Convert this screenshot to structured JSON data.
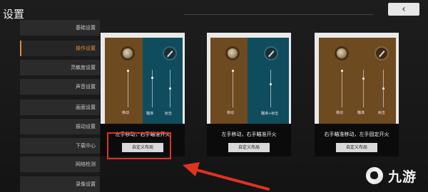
{
  "header": {
    "title": "设置",
    "close_icon": "back-arrow-icon"
  },
  "sidebar": {
    "items": [
      {
        "label": "基础设置",
        "active": false
      },
      {
        "label": "操作设置",
        "active": true
      },
      {
        "label": "灵敏度设置",
        "active": false
      },
      {
        "label": "声音设置",
        "active": false
      },
      {
        "label": "画面设置",
        "active": false
      },
      {
        "label": "振动设置",
        "active": false
      },
      {
        "label": "下载中心",
        "active": false
      },
      {
        "label": "网络检测",
        "active": false
      },
      {
        "label": "录像设置",
        "active": false
      }
    ]
  },
  "layouts": [
    {
      "labels": {
        "move": "移动",
        "aim": "瞄准",
        "fire": "射击"
      },
      "caption": "左手移动，右手瞄准开火",
      "button": "自定义布局"
    },
    {
      "labels": {
        "move": "移动",
        "aim_fire": "瞄准+射击"
      },
      "caption": "左手移动，右手瞄准开火",
      "button": "自定义布局"
    },
    {
      "labels": {
        "move": "移动",
        "aim": "瞄准",
        "fire": "射击"
      },
      "caption": "右手瞄准移动，左手固定开火",
      "button": "自定义布局"
    }
  ],
  "annotation": {
    "color": "#e03322"
  },
  "colors": {
    "accent": "#e08a43",
    "brown_pane": "#6e4a20",
    "teal_pane": "#0f4d5e"
  },
  "watermark": {
    "logo_icon": "jiuyou-logo-icon",
    "text": "九游"
  }
}
